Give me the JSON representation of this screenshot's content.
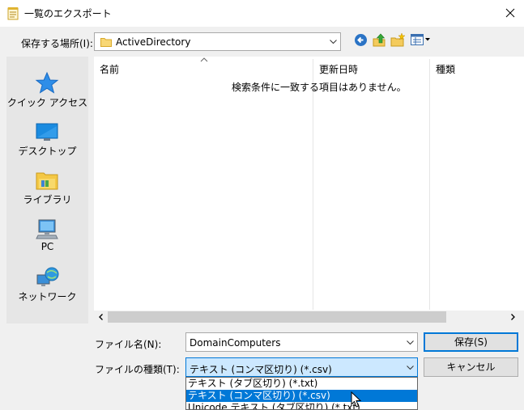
{
  "window": {
    "title": "一覧のエクスポート"
  },
  "location": {
    "label": "保存する場所(I):",
    "value": "ActiveDirectory"
  },
  "places": [
    {
      "label": "クイック アクセス",
      "icon": "star-icon"
    },
    {
      "label": "デスクトップ",
      "icon": "desktop-icon"
    },
    {
      "label": "ライブラリ",
      "icon": "library-folder-icon"
    },
    {
      "label": "PC",
      "icon": "computer-icon"
    },
    {
      "label": "ネットワーク",
      "icon": "network-icon"
    }
  ],
  "filelist": {
    "columns": [
      "名前",
      "更新日時",
      "種類"
    ],
    "empty_message": "検索条件に一致する項目はありません。"
  },
  "filename": {
    "label": "ファイル名(N):",
    "value": "DomainComputers"
  },
  "filetype": {
    "label": "ファイルの種類(T):",
    "value": "テキスト (コンマ区切り) (*.csv)",
    "options": [
      "テキスト (タブ区切り) (*.txt)",
      "テキスト (コンマ区切り) (*.csv)",
      "Unicode テキスト (タブ区切り) (*.txt)"
    ]
  },
  "buttons": {
    "save": "保存(S)",
    "cancel": "キャンセル"
  },
  "colors": {
    "accent": "#0078d7",
    "selection_bg": "#cce8ff"
  }
}
